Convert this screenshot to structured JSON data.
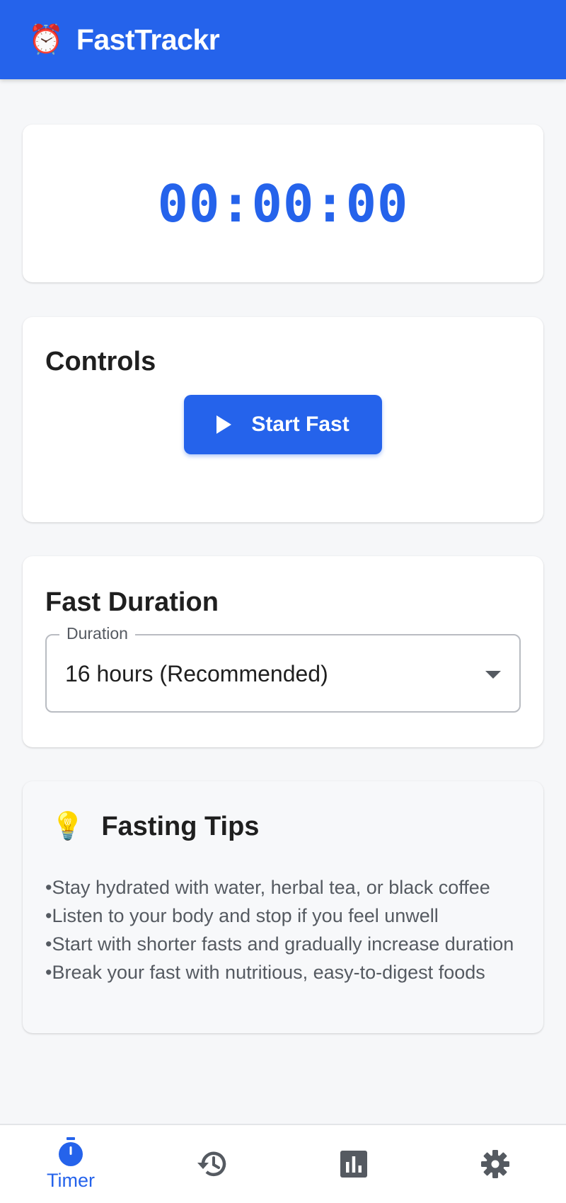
{
  "app": {
    "title": "FastTrackr",
    "logo_icon": "alarm-clock-icon",
    "brand_color": "#2563eb"
  },
  "timer": {
    "display": "00:00:00"
  },
  "controls": {
    "heading": "Controls",
    "start_button_label": "Start Fast",
    "start_button_icon": "play-icon"
  },
  "duration": {
    "heading": "Fast Duration",
    "field_label": "Duration",
    "selected_value": "16 hours (Recommended)"
  },
  "tips": {
    "icon": "lightbulb-icon",
    "heading": "Fasting Tips",
    "items": [
      "Stay hydrated with water, herbal tea, or black coffee",
      "Listen to your body and stop if you feel unwell",
      "Start with shorter fasts and gradually increase duration",
      "Break your fast with nutritious, easy-to-digest foods"
    ]
  },
  "bottom_nav": {
    "items": [
      {
        "label": "Timer",
        "icon": "stopwatch-icon",
        "active": true
      },
      {
        "label": "",
        "icon": "history-icon",
        "active": false
      },
      {
        "label": "",
        "icon": "bar-chart-icon",
        "active": false
      },
      {
        "label": "",
        "icon": "settings-gear-icon",
        "active": false
      }
    ],
    "active_color": "#2563eb",
    "inactive_color": "#555a61"
  }
}
